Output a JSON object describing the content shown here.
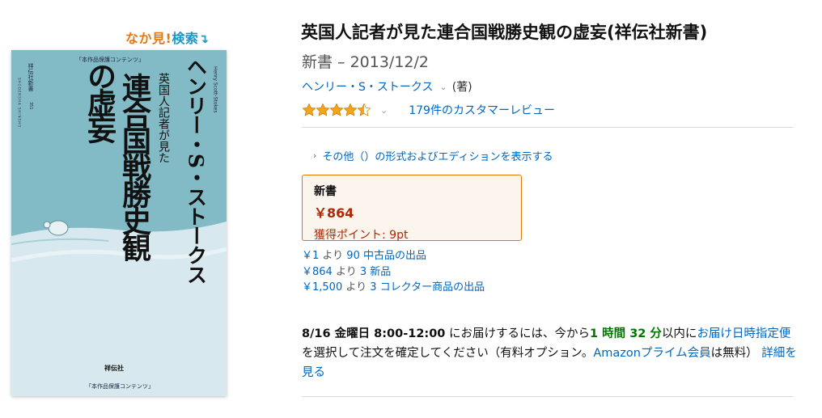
{
  "look_inside": {
    "part1": "なか見!",
    "part2": "検索",
    "arrow": "↴"
  },
  "cover": {
    "top_label": "「本作品保護コンテンツ」",
    "series": "祥伝社新書",
    "series_num": "351",
    "series_en": "SHODENSHA SHINSHO",
    "title_line1": "英国人記者が見た",
    "title_line2": "連合国戦勝史観",
    "title_line3": "の虚妄",
    "author_jp": "ヘンリー・S・ストークス",
    "author_en": "Henry Scott-Stokes",
    "publisher": "祥伝社",
    "bottom_label": "「本作品保護コンテンツ」"
  },
  "product": {
    "title": "英国人記者が見た連合国戦勝史観の虚妄(祥伝社新書)",
    "edition": "新書 – 2013/12/2",
    "author": "ヘンリー・S・ストークス",
    "author_role": "(著)",
    "rating": 4.5,
    "reviews_link": "179件のカスタマーレビュー",
    "formats_link": "その他（）の形式およびエディションを表示する"
  },
  "price_box": {
    "format": "新書",
    "price": "￥864",
    "points": "獲得ポイント: 9pt"
  },
  "offers": [
    {
      "price": "￥1",
      "from": " より ",
      "link": "90 中古品の出品"
    },
    {
      "price": "￥864",
      "from": " より ",
      "link": "3 新品"
    },
    {
      "price": "￥1,500",
      "from": " より ",
      "link": "3 コレクター商品の出品"
    }
  ],
  "delivery": {
    "date": "8/16 金曜日 8:00-12:00",
    "text1": " にお届けするには、今から",
    "countdown": "1 時間 32 分",
    "text2": "以内に",
    "link1": "お届け日時指定便",
    "text3": "を選択して注文を確定してください（有料オプション。",
    "link2": "Amazonプライム会員",
    "text4": "は無料）",
    "link3": "詳細を見る"
  },
  "colors": {
    "link": "#0066c0",
    "price_red": "#b12704",
    "accent_orange": "#e77600",
    "countdown_green": "#007600",
    "star_gold": "#f4a41d"
  }
}
